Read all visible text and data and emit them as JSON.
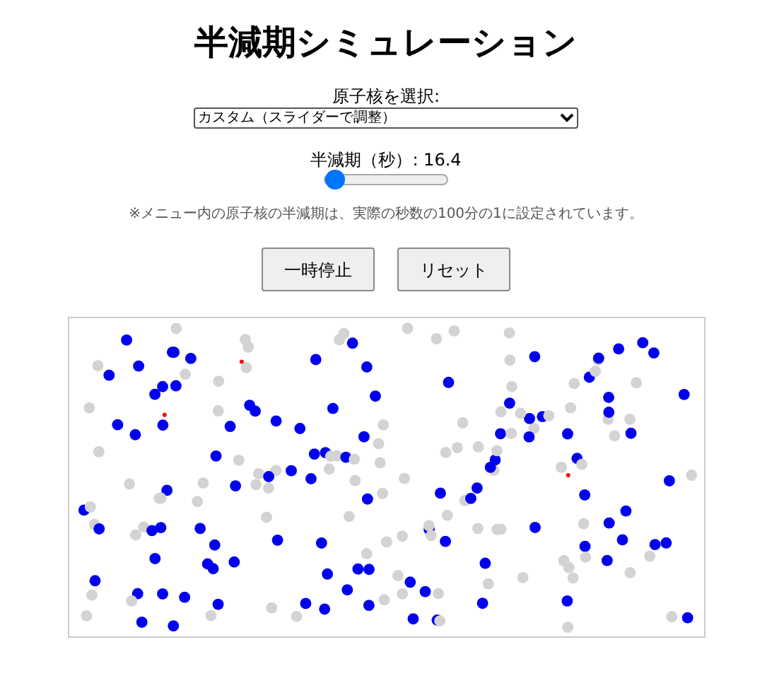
{
  "title": "半減期シミュレーション",
  "nucleus_select": {
    "label": "原子核を選択:",
    "value": "カスタム（スライダーで調整）"
  },
  "half_life": {
    "label": "半減期（秒）: 16.4",
    "level": 0.08
  },
  "note": "※メニュー内の原子核の半減期は、実際の秒数の100分の1に設定されています。",
  "buttons": [
    "一時停止",
    "リセット"
  ]
}
